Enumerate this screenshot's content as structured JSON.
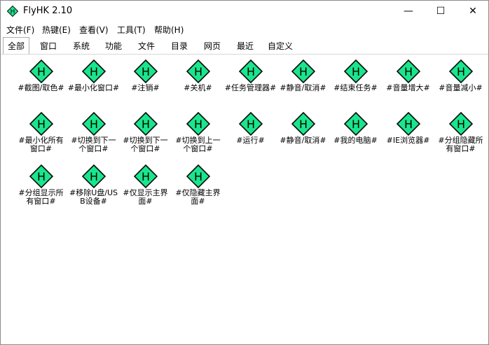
{
  "window": {
    "title": "FlyHK 2.10",
    "icon_letter": "H"
  },
  "controls": {
    "minimize": "—",
    "maximize": "☐",
    "close": "✕"
  },
  "menu": [
    "文件(F)",
    "热键(E)",
    "查看(V)",
    "工具(T)",
    "帮助(H)"
  ],
  "tabs": [
    {
      "label": "全部",
      "active": true
    },
    {
      "label": "窗口"
    },
    {
      "label": "系统"
    },
    {
      "label": "功能"
    },
    {
      "label": "文件"
    },
    {
      "label": "目录"
    },
    {
      "label": "网页"
    },
    {
      "label": "最近"
    },
    {
      "label": "自定义"
    }
  ],
  "icon": {
    "letter": "H",
    "fill": "#19e68c",
    "stroke": "#0b0b0b"
  },
  "items": [
    "#截图/取色#",
    "#最小化窗口#",
    "#注销#",
    "#关机#",
    "#任务管理器#",
    "#静音/取消#",
    "#结束任务#",
    "#音量增大#",
    "#音量减小#",
    "#最小化所有窗口#",
    "#切换到下一个窗口#",
    "#切换到下一个窗口#",
    "#切换到上一个窗口#",
    "#运行#",
    "#静音/取消#",
    "#我的电脑#",
    "#IE浏览器#",
    "#分组隐藏所有窗口#",
    "#分组显示所有窗口#",
    "#移除U盘/USB设备#",
    "#仅显示主界面#",
    "#仅隐藏主界面#"
  ]
}
